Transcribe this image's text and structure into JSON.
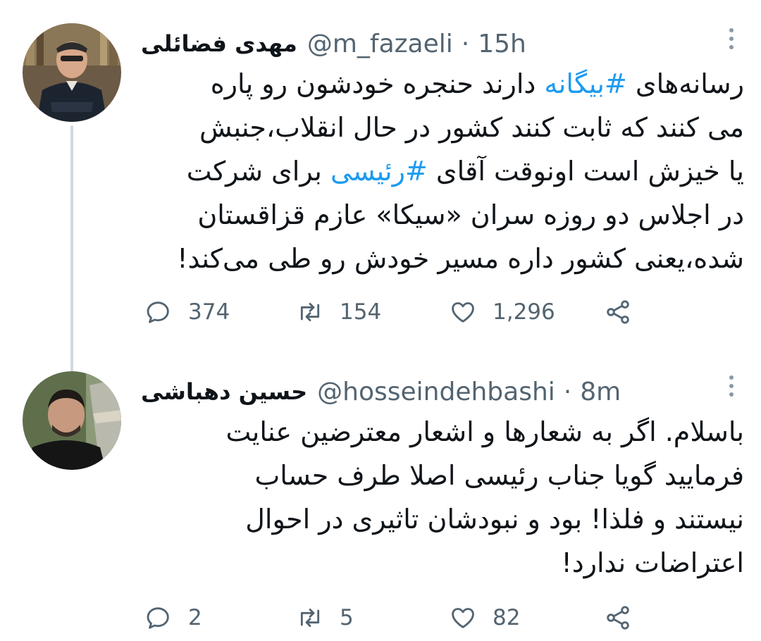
{
  "tweets": [
    {
      "name": "مهدی فضائلی",
      "handle": "@m_fazaeli",
      "separator": "·",
      "time": "15h",
      "lines": [
        {
          "pre": "رسانه‌های ",
          "tag": "#بیگانه",
          "post": " دارند حنجره خودشون رو پاره"
        },
        {
          "pre": "می کنند که ثابت کنند کشور در حال انقلاب،جنبش",
          "tag": "",
          "post": ""
        },
        {
          "pre": "یا خیزش است اونوقت آقای ",
          "tag": "#رئیسی",
          "post": " برای شرکت"
        },
        {
          "pre": "در اجلاس دو روزه سران «سیکا» عازم قزاقستان",
          "tag": "",
          "post": ""
        },
        {
          "pre": "شده،یعنی کشور داره مسیر خودش رو طی می‌کند!",
          "tag": "",
          "post": ""
        }
      ],
      "replies": "374",
      "retweets": "154",
      "likes": "1,296"
    },
    {
      "name": "حسین دهباشی",
      "handle": "@hosseindehbashi",
      "separator": "·",
      "time": "8m",
      "lines": [
        {
          "pre": "باسلام. اگر به شعارها و اشعار معترضین عنایت",
          "tag": "",
          "post": ""
        },
        {
          "pre": "فرمایید گویا جناب رئیسی اصلا طرف حساب",
          "tag": "",
          "post": ""
        },
        {
          "pre": "نیستند و فلذا! بود و نبودشان تاثیری در احوال",
          "tag": "",
          "post": ""
        },
        {
          "pre": "اعتراضات ندارد!",
          "tag": "",
          "post": ""
        }
      ],
      "replies": "2",
      "retweets": "5",
      "likes": "82"
    }
  ],
  "colors": {
    "text": "#0f1419",
    "secondary": "#536471",
    "link": "#1d9bf0",
    "thread_line": "#cfd9de"
  },
  "icons": [
    "reply-icon",
    "retweet-icon",
    "like-icon",
    "share-icon",
    "more-icon"
  ]
}
